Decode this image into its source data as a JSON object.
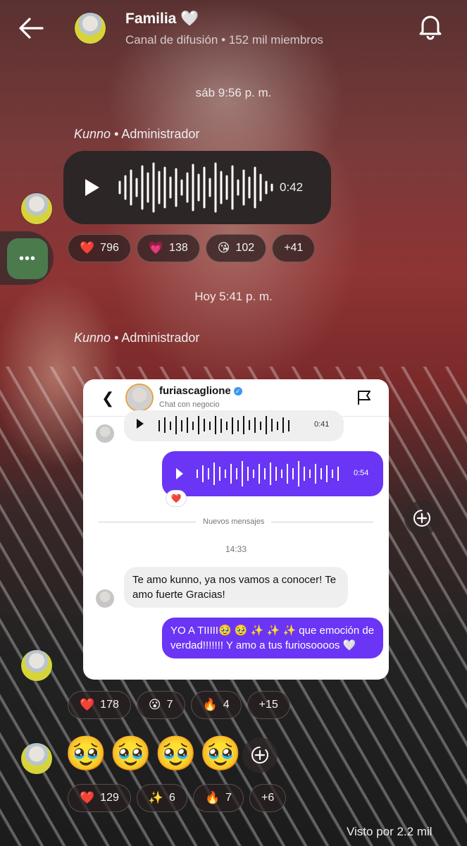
{
  "header": {
    "title": "Familia 🤍",
    "subtitle": "Canal de difusión • 152 mil miembros"
  },
  "feed": {
    "timestamp1": "sáb 9:56 p. m.",
    "post1": {
      "author": "Kunno",
      "role": " • Administrador",
      "voice_duration": "0:42",
      "reactions": [
        {
          "emoji": "❤️",
          "count": "796"
        },
        {
          "emoji": "💗",
          "count": "138"
        },
        {
          "emoji": "😘",
          "count": "102"
        },
        {
          "emoji": "",
          "count": "+41"
        }
      ]
    },
    "timestamp2": "Hoy 5:41 p. m.",
    "post2": {
      "author": "Kunno",
      "role": " • Administrador",
      "reactions": [
        {
          "emoji": "❤️",
          "count": "178"
        },
        {
          "emoji": "😮",
          "count": "7"
        },
        {
          "emoji": "🔥",
          "count": "4"
        },
        {
          "emoji": "",
          "count": "+15"
        }
      ]
    },
    "post3": {
      "emojis": "🥹🥹🥹🥹",
      "reactions": [
        {
          "emoji": "❤️",
          "count": "129"
        },
        {
          "emoji": "✨",
          "count": "6"
        },
        {
          "emoji": "🔥",
          "count": "7"
        },
        {
          "emoji": "",
          "count": "+6"
        }
      ]
    },
    "seen_by": "Visto por 2.2 mil"
  },
  "screenshot": {
    "name": "furiascaglione",
    "subtitle": "Chat con negocio",
    "voice1_duration": "0:41",
    "voice2_duration": "0:54",
    "voice2_reaction": "❤️",
    "divider_label": "Nuevos mensajes",
    "time": "14:33",
    "incoming_message": "Te amo kunno, ya nos vamos a conocer! Te amo fuerte Gracias!",
    "outgoing_message": "YO A TIIIII🥹 🥹 ✨ ✨ ✨  que emoción de verdad!!!!!!! Y amo a tus furiosoooos 🤍"
  },
  "icons": {
    "back": "arrow-left-icon",
    "bell": "bell-icon",
    "more": "more-dots-icon",
    "add_reaction": "add-reaction-icon",
    "flag": "flag-icon"
  },
  "colors": {
    "voice_bubble": "#2d2626",
    "purple_bubble": "#6a35f5",
    "more_button": "#4b7a4d"
  }
}
